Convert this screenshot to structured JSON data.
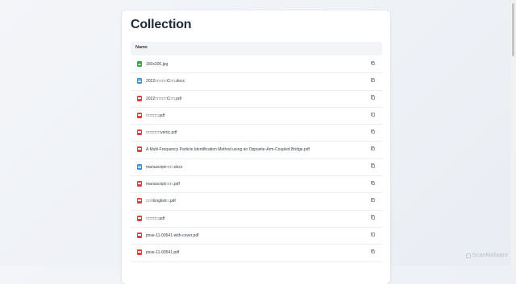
{
  "page": {
    "title": "Collection"
  },
  "table": {
    "column_name": "Name",
    "rows": [
      {
        "name": "150x200.jpg",
        "type": "image"
      },
      {
        "name": "2022□□□□□C□□.docx",
        "type": "docx"
      },
      {
        "name": "2022□□□□□C□□.pdf",
        "type": "pdf"
      },
      {
        "name": "□□□□□.pdf",
        "type": "pdf"
      },
      {
        "name": "□□□□□□vertic.pdf",
        "type": "pdf"
      },
      {
        "name": "A Multi-Frequency Particle Identification Method using an Opposite-Arm-Coupled Bridge.pdf",
        "type": "pdf"
      },
      {
        "name": "manuscript□□□.docx",
        "type": "docx"
      },
      {
        "name": "manuscript□□□.pdf",
        "type": "pdf"
      },
      {
        "name": "□□□English□.pdf",
        "type": "pdf"
      },
      {
        "name": "□□□□□.pdf",
        "type": "pdf"
      },
      {
        "name": "jmse-11-00541-with-cover.pdf",
        "type": "pdf"
      },
      {
        "name": "jmse-11-00541.pdf",
        "type": "pdf"
      }
    ]
  },
  "watermark": {
    "text": "ScanMalware"
  },
  "colors": {
    "image": "#36a852",
    "docx": "#3b8ce0",
    "pdf": "#e3413a"
  }
}
